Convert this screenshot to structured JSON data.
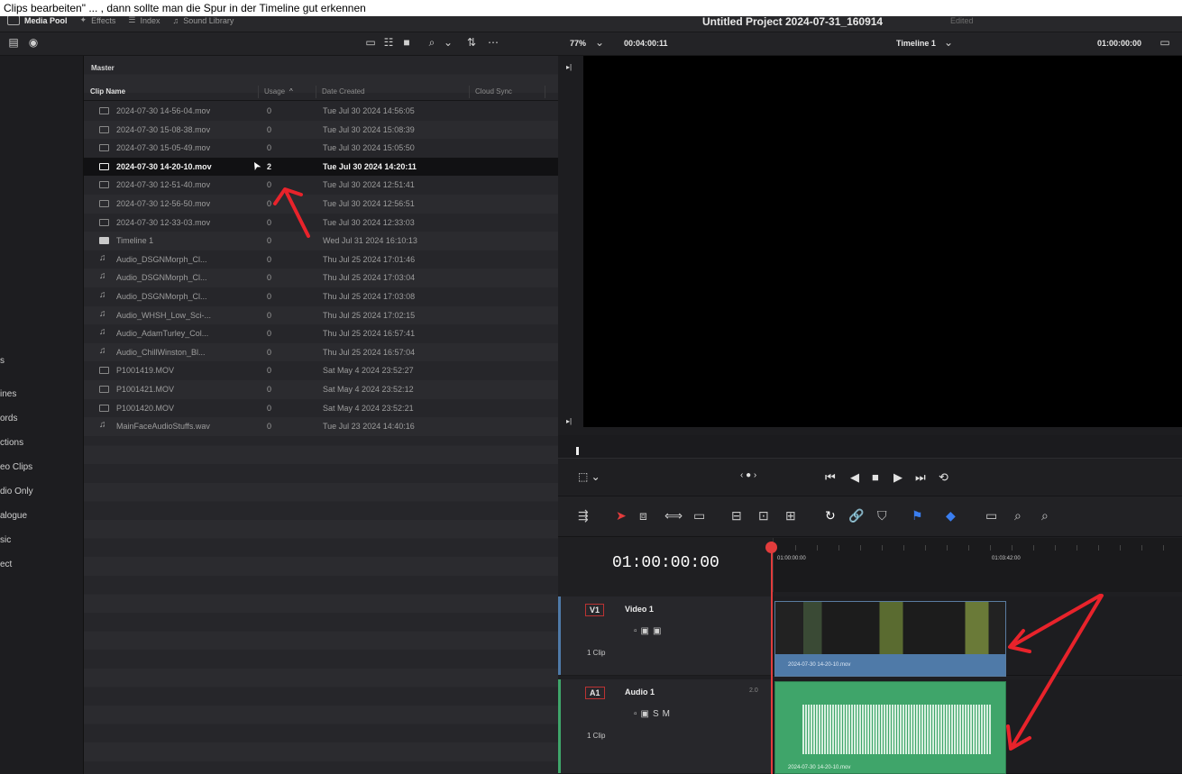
{
  "overlay_caption": "Clips bearbeiten\" ... , dann sollte man die Spur in der Timeline gut erkennen",
  "top_tabs": [
    {
      "label": "Media Pool",
      "active": true
    },
    {
      "label": "Effects",
      "active": false
    },
    {
      "label": "Index",
      "active": false
    },
    {
      "label": "Sound Library",
      "active": false
    }
  ],
  "project": {
    "title": "Untitled Project 2024-07-31_160914",
    "state": "Edited"
  },
  "viewer_bar": {
    "zoom": "77%",
    "source_timecode": "00:04:00:11",
    "timeline_select": "Timeline 1",
    "record_timecode": "01:00:00:00"
  },
  "bins": {
    "labels": [
      "s",
      "ines",
      "ords",
      "ctions",
      "eo Clips",
      "dio Only",
      "alogue",
      "sic",
      "ect"
    ]
  },
  "pool": {
    "folder": "Master",
    "columns": {
      "name": "Clip Name",
      "usage": "Usage",
      "date": "Date Created",
      "sync": "Cloud Sync"
    },
    "clips": [
      {
        "name": "2024-07-30 14-56-04.mov",
        "usage": "0",
        "date": "Tue Jul 30 2024 14:56:05",
        "kind": "video"
      },
      {
        "name": "2024-07-30 15-08-38.mov",
        "usage": "0",
        "date": "Tue Jul 30 2024 15:08:39",
        "kind": "video"
      },
      {
        "name": "2024-07-30 15-05-49.mov",
        "usage": "0",
        "date": "Tue Jul 30 2024 15:05:50",
        "kind": "video"
      },
      {
        "name": "2024-07-30 14-20-10.mov",
        "usage": "2",
        "date": "Tue Jul 30 2024 14:20:11",
        "kind": "video",
        "selected": true
      },
      {
        "name": "2024-07-30 12-51-40.mov",
        "usage": "0",
        "date": "Tue Jul 30 2024 12:51:41",
        "kind": "video"
      },
      {
        "name": "2024-07-30 12-56-50.mov",
        "usage": "0",
        "date": "Tue Jul 30 2024 12:56:51",
        "kind": "video"
      },
      {
        "name": "2024-07-30 12-33-03.mov",
        "usage": "0",
        "date": "Tue Jul 30 2024 12:33:03",
        "kind": "video"
      },
      {
        "name": "Timeline 1",
        "usage": "0",
        "date": "Wed Jul 31 2024 16:10:13",
        "kind": "timeline"
      },
      {
        "name": "Audio_DSGNMorph_Cl...",
        "usage": "0",
        "date": "Thu Jul 25 2024 17:01:46",
        "kind": "audio"
      },
      {
        "name": "Audio_DSGNMorph_Cl...",
        "usage": "0",
        "date": "Thu Jul 25 2024 17:03:04",
        "kind": "audio"
      },
      {
        "name": "Audio_DSGNMorph_Cl...",
        "usage": "0",
        "date": "Thu Jul 25 2024 17:03:08",
        "kind": "audio"
      },
      {
        "name": "Audio_WHSH_Low_Sci-...",
        "usage": "0",
        "date": "Thu Jul 25 2024 17:02:15",
        "kind": "audio"
      },
      {
        "name": "Audio_AdamTurley_Col...",
        "usage": "0",
        "date": "Thu Jul 25 2024 16:57:41",
        "kind": "audio"
      },
      {
        "name": "Audio_ChillWinston_Bl...",
        "usage": "0",
        "date": "Thu Jul 25 2024 16:57:04",
        "kind": "audio"
      },
      {
        "name": "P1001419.MOV",
        "usage": "0",
        "date": "Sat May 4 2024 23:52:27",
        "kind": "video"
      },
      {
        "name": "P1001421.MOV",
        "usage": "0",
        "date": "Sat May 4 2024 23:52:12",
        "kind": "video"
      },
      {
        "name": "P1001420.MOV",
        "usage": "0",
        "date": "Sat May 4 2024 23:52:21",
        "kind": "video"
      },
      {
        "name": "MainFaceAudioStuffs.wav",
        "usage": "0",
        "date": "Tue Jul 23 2024 14:40:16",
        "kind": "audio"
      }
    ]
  },
  "timeline": {
    "timecode": "01:00:00:00",
    "ruler_marks": [
      "01:00:00:00",
      "01:03:42:00"
    ],
    "tracks": [
      {
        "tag": "V1",
        "name": "Video 1",
        "clip_count": "1 Clip",
        "clip_label": "2024-07-30 14-20-10.mov",
        "color": "#4f7aa8"
      },
      {
        "tag": "A1",
        "name": "Audio 1",
        "channels": "2.0",
        "clip_count": "1 Clip",
        "clip_label": "2024-07-30 14-20-10.mov",
        "color": "#3fa56a"
      }
    ]
  },
  "accent_colors": {
    "annotation_arrow": "#e8232b",
    "playhead": "#e23c3c"
  }
}
